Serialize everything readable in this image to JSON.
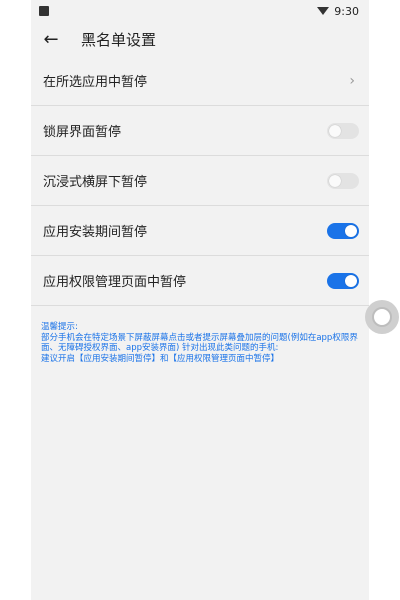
{
  "status_bar": {
    "time": "9:30"
  },
  "header": {
    "title": "黑名单设置"
  },
  "settings": [
    {
      "label": "在所选应用中暂停",
      "control": "chevron",
      "chevron": "›"
    },
    {
      "label": "锁屏界面暂停",
      "control": "toggle",
      "on": false
    },
    {
      "label": "沉浸式横屏下暂停",
      "control": "toggle",
      "on": false
    },
    {
      "label": "应用安装期间暂停",
      "control": "toggle",
      "on": true
    },
    {
      "label": "应用权限管理页面中暂停",
      "control": "toggle",
      "on": true
    }
  ],
  "tips": {
    "title": "温馨提示:",
    "body": "部分手机会在特定场景下屏蔽屏幕点击或者提示屏幕叠加层的问题(例如在app权限界面、无障碍授权界面、app安装界面) 针对出现此类问题的手机:",
    "suggestion": "建议开启【应用安装期间暂停】和【应用权限管理页面中暂停】"
  },
  "colors": {
    "accent": "#1a73e8",
    "background": "#f2f2f2"
  }
}
